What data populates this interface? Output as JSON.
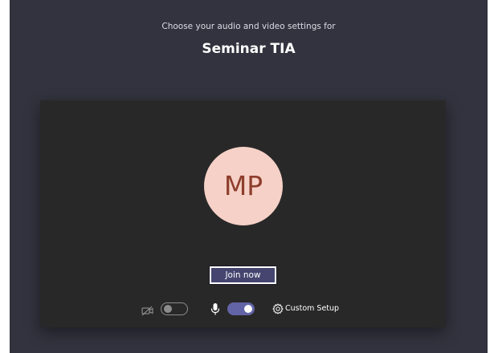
{
  "header": {
    "subtitle": "Choose your audio and video settings for",
    "meeting_title": "Seminar TIA"
  },
  "preview": {
    "avatar_initials": "MP",
    "join_button_label": "Join now"
  },
  "controls": {
    "camera_icon": "camera-off-icon",
    "camera_on": false,
    "mic_icon": "microphone-icon",
    "mic_on": true,
    "settings_icon": "gear-icon",
    "custom_setup_label": "Custom Setup"
  },
  "colors": {
    "background": "#33333f",
    "preview_background": "#292828",
    "avatar_background": "#f6d1c7",
    "avatar_text": "#8e3e2c",
    "accent": "#6264a7"
  }
}
